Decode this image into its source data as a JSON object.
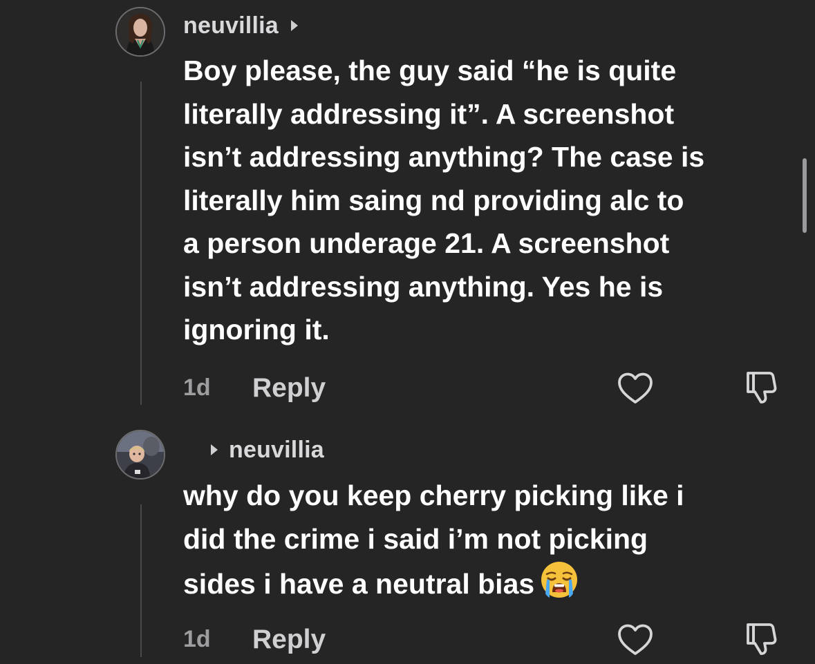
{
  "comments": [
    {
      "username": "neuvillia",
      "text": "Boy please, the guy said “he is quite\nliterally addressing it”. A screenshot\nisn’t addressing anything? The case is\nliterally him saing nd providing alc to\na person underage 21. A screenshot\nisn’t addressing anything. Yes he is\nignoring it.",
      "time": "1d",
      "reply_label": "Reply",
      "icons": [
        "caret-right-icon",
        "heart-icon",
        "dislike-icon"
      ]
    },
    {
      "reply_to": "neuvillia",
      "text": "why do you keep cherry picking like i\ndid the crime i said i’m not picking\nsides i have a neutral bias",
      "emoji": "loudly-crying-face-emoji",
      "time": "1d",
      "reply_label": "Reply",
      "icons": [
        "caret-right-icon",
        "heart-icon",
        "dislike-icon"
      ]
    }
  ],
  "colors": {
    "background": "#252526",
    "text": "#ffffff",
    "username": "#d9d9db",
    "meta": "#9e9ea0",
    "thread_line": "#4a4a4c"
  }
}
